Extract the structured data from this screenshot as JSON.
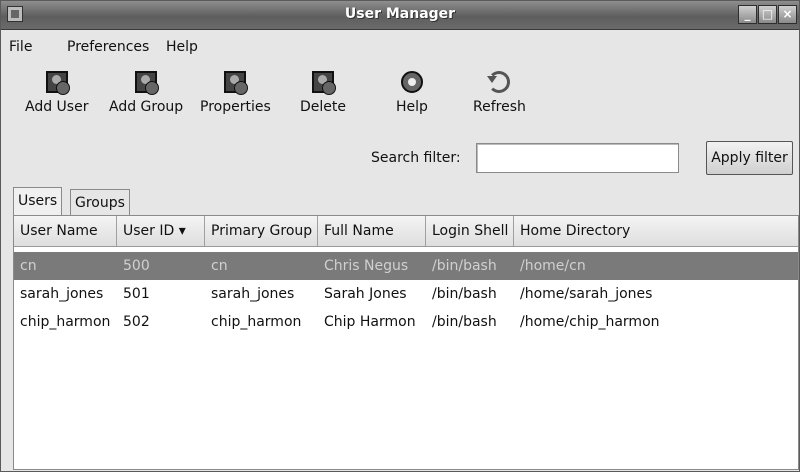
{
  "window": {
    "title": "User Manager"
  },
  "menubar": {
    "file": "File",
    "preferences": "Preferences",
    "help": "Help"
  },
  "toolbar": {
    "add_user": "Add User",
    "add_group": "Add Group",
    "properties": "Properties",
    "delete": "Delete",
    "help": "Help",
    "refresh": "Refresh"
  },
  "search": {
    "label": "Search filter:",
    "value": "",
    "apply_label": "Apply filter"
  },
  "tabs": [
    {
      "label": "Users"
    },
    {
      "label": "Groups"
    }
  ],
  "table": {
    "columns": [
      "User Name",
      "User ID ▾",
      "Primary Group",
      "Full Name",
      "Login Shell",
      "Home Directory"
    ],
    "rows": [
      [
        "cn",
        "500",
        "cn",
        "Chris Negus",
        "/bin/bash",
        "/home/cn"
      ],
      [
        "sarah_jones",
        "501",
        "sarah_jones",
        "Sarah Jones",
        "/bin/bash",
        "/home/sarah_jones"
      ],
      [
        "chip_harmon",
        "502",
        "chip_harmon",
        "Chip Harmon",
        "/bin/bash",
        "/home/chip_harmon"
      ]
    ],
    "selected_row": 0
  },
  "icons": {
    "add_user": "add-user-icon",
    "add_group": "add-group-icon",
    "properties": "properties-icon",
    "delete": "delete-icon",
    "help": "help-icon",
    "refresh": "refresh-icon"
  }
}
